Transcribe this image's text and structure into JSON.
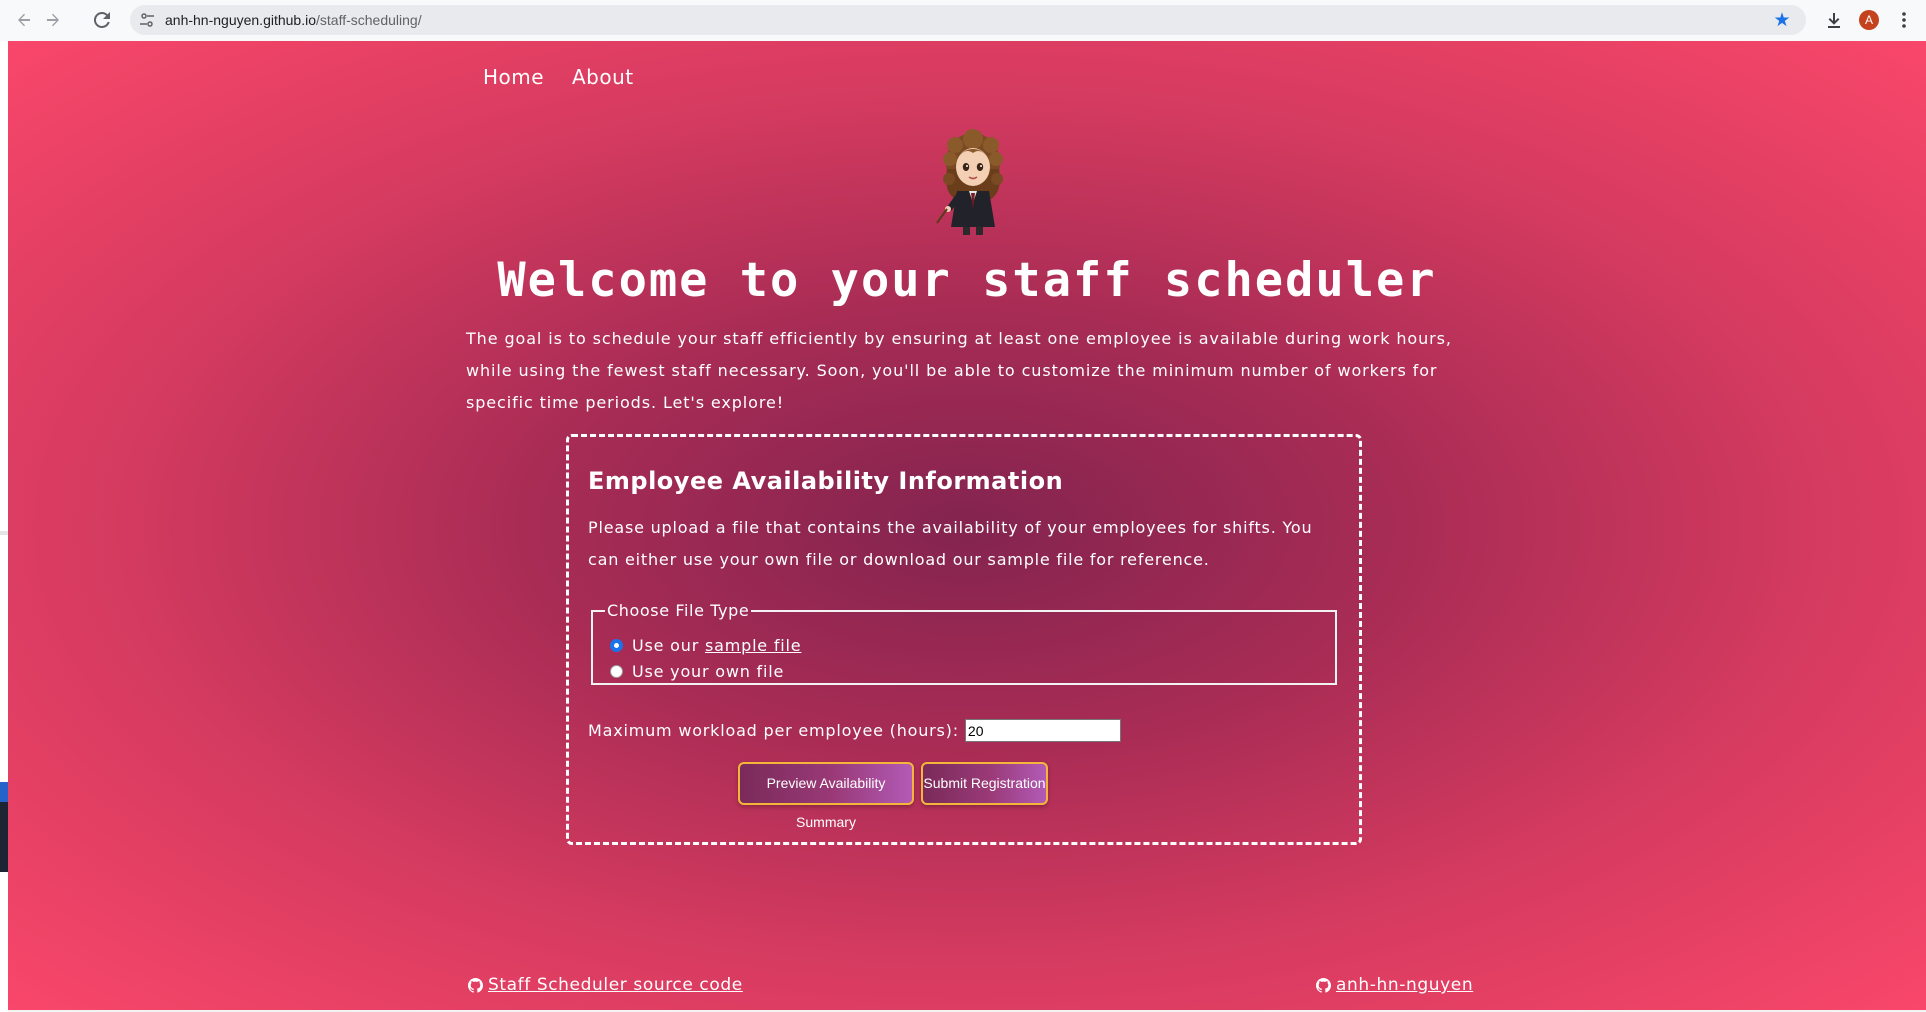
{
  "browser": {
    "url_host": "anh-hn-nguyen.github.io",
    "url_path": "/staff-scheduling/",
    "profile_initial": "A",
    "icons": {
      "back": "arrow-left-icon",
      "forward": "arrow-right-icon",
      "reload": "reload-icon",
      "site_info": "tune-icon",
      "bookmark": "star-icon",
      "downloads": "download-icon",
      "menu": "kebab-menu-icon"
    },
    "accent_color": "#1a73e8"
  },
  "nav": {
    "items": [
      {
        "label": "Home"
      },
      {
        "label": "About"
      }
    ]
  },
  "hero": {
    "image": "cartoon-character-avatar",
    "title": "Welcome to your staff scheduler",
    "intro": "The goal is to schedule your staff efficiently by ensuring at least one employee is available during work hours, while using the fewest staff necessary. Soon, you'll be able to customize the minimum number of workers for specific time periods. Let's explore!"
  },
  "form": {
    "title": "Employee Availability Information",
    "description": "Please upload a file that contains the availability of your employees for shifts. You can either use your own file or download our sample file for reference.",
    "file_type": {
      "legend": "Choose File Type",
      "options": [
        {
          "prefix": "Use our ",
          "link": "sample file",
          "selected": true
        },
        {
          "label": "Use your own file",
          "selected": false
        }
      ]
    },
    "workload": {
      "label": "Maximum workload per employee (hours):",
      "value": "20"
    },
    "buttons": {
      "preview": "Preview Availability Summary",
      "submit": "Submit Registration"
    }
  },
  "footer": {
    "source_link": "Staff Scheduler source code",
    "author_link": "anh-hn-nguyen",
    "icon": "github-icon"
  },
  "theme": {
    "background_center": "#83244f",
    "background_edge": "#f9476a",
    "button_border": "#f4b63a"
  }
}
